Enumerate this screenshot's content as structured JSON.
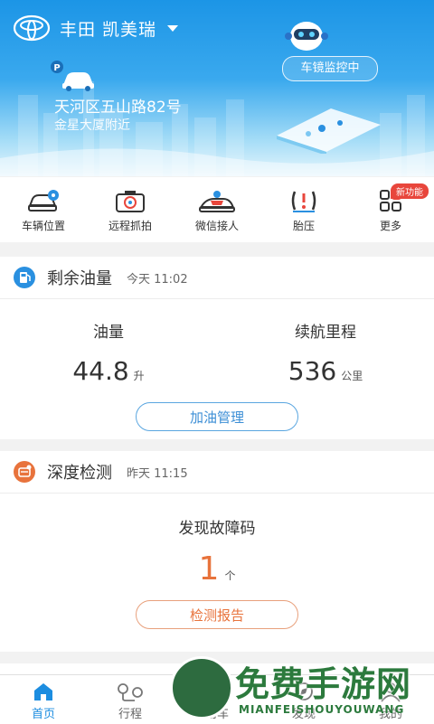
{
  "header": {
    "brand_icon": "toyota-logo-icon",
    "car_title": "丰田 凯美瑞",
    "address_main": "天河区五山路82号",
    "address_sub": "金星大厦附近",
    "monitor_banner": "车镜监控中",
    "parking_label": "P"
  },
  "quick_actions": [
    {
      "label": "车辆位置",
      "icon": "car-location-icon"
    },
    {
      "label": "远程抓拍",
      "icon": "camera-icon"
    },
    {
      "label": "微信接人",
      "icon": "pickup-car-icon"
    },
    {
      "label": "胎压",
      "icon": "tire-pressure-icon"
    },
    {
      "label": "更多",
      "icon": "grid-more-icon",
      "badge": "新功能"
    }
  ],
  "fuel_card": {
    "title": "剩余油量",
    "time": "今天 11:02",
    "fuel_label": "油量",
    "fuel_value": "44.8",
    "fuel_unit": "升",
    "range_label": "续航里程",
    "range_value": "536",
    "range_unit": "公里",
    "button": "加油管理"
  },
  "diag_card": {
    "title": "深度检测",
    "time": "昨天 11:15",
    "found_label": "发现故障码",
    "count": "1",
    "count_unit": "个",
    "button": "检测报告"
  },
  "tabs": [
    {
      "label": "首页",
      "icon": "home-icon",
      "active": true
    },
    {
      "label": "行程",
      "icon": "trip-icon"
    },
    {
      "label": "用车",
      "icon": "car-use-icon"
    },
    {
      "label": "发现",
      "icon": "discover-icon"
    },
    {
      "label": "我的",
      "icon": "profile-icon"
    }
  ],
  "watermark": {
    "main": "免费手游网",
    "sub": "MIANFEISHOUYOUWANG"
  },
  "colors": {
    "accent": "#1c8de0",
    "orange": "#e8733c",
    "badge_red": "#e8463c",
    "header_top": "#1c95e6"
  }
}
